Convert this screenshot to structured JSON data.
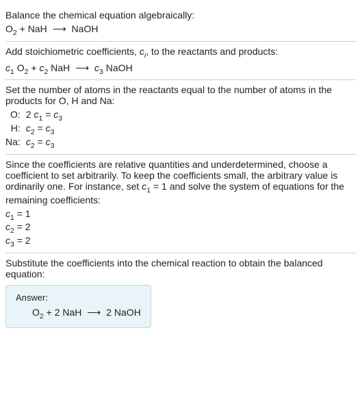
{
  "section1": {
    "intro": "Balance the chemical equation algebraically:",
    "eq_left": "O",
    "eq_left_sub": "2",
    "eq_plus": " + NaH ",
    "eq_arrow": "⟶",
    "eq_right": " NaOH"
  },
  "section2": {
    "intro_a": "Add stoichiometric coefficients, ",
    "intro_ci": "c",
    "intro_ci_sub": "i",
    "intro_b": ", to the reactants and products:",
    "c1": "c",
    "c1_sub": "1",
    "o2": " O",
    "o2_sub": "2",
    "plus": " + ",
    "c2": "c",
    "c2_sub": "2",
    "nah": " NaH ",
    "arrow": "⟶",
    "c3": " c",
    "c3_sub": "3",
    "naoh": " NaOH"
  },
  "section3": {
    "intro": "Set the number of atoms in the reactants equal to the number of atoms in the products for O, H and Na:",
    "rows": [
      {
        "label": "O:",
        "lhs_a": "2 ",
        "lhs_c": "c",
        "lhs_sub": "1",
        "eq": " = ",
        "rhs_c": "c",
        "rhs_sub": "3"
      },
      {
        "label": "H:",
        "lhs_a": "",
        "lhs_c": "c",
        "lhs_sub": "2",
        "eq": " = ",
        "rhs_c": "c",
        "rhs_sub": "3"
      },
      {
        "label": "Na:",
        "lhs_a": "",
        "lhs_c": "c",
        "lhs_sub": "2",
        "eq": " = ",
        "rhs_c": "c",
        "rhs_sub": "3"
      }
    ]
  },
  "section4": {
    "intro_a": "Since the coefficients are relative quantities and underdetermined, choose a coefficient to set arbitrarily. To keep the coefficients small, the arbitrary value is ordinarily one. For instance, set ",
    "intro_c": "c",
    "intro_c_sub": "1",
    "intro_b": " = 1 and solve the system of equations for the remaining coefficients:",
    "lines": [
      {
        "c": "c",
        "sub": "1",
        "val": " = 1"
      },
      {
        "c": "c",
        "sub": "2",
        "val": " = 2"
      },
      {
        "c": "c",
        "sub": "3",
        "val": " = 2"
      }
    ]
  },
  "section5": {
    "intro": "Substitute the coefficients into the chemical reaction to obtain the balanced equation:",
    "answer_label": "Answer:",
    "eq_a": "O",
    "eq_a_sub": "2",
    "eq_b": " + 2 NaH ",
    "eq_arrow": "⟶",
    "eq_c": " 2 NaOH"
  }
}
